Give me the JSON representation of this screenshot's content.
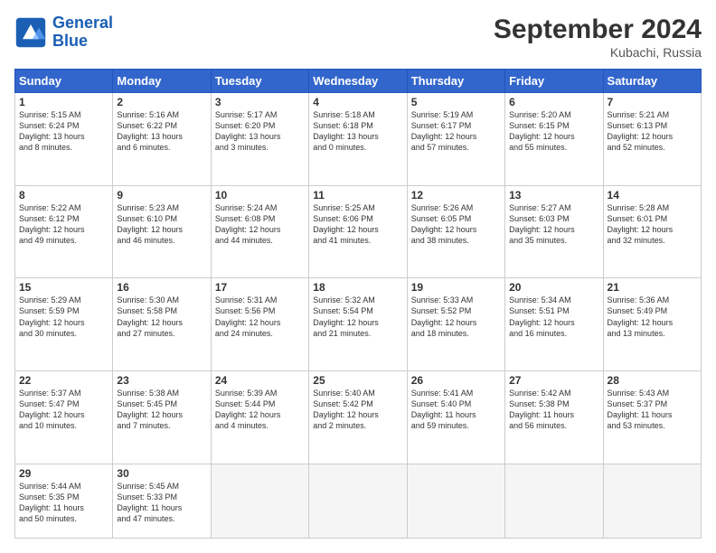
{
  "logo": {
    "line1": "General",
    "line2": "Blue"
  },
  "title": "September 2024",
  "location": "Kubachi, Russia",
  "days_header": [
    "Sunday",
    "Monday",
    "Tuesday",
    "Wednesday",
    "Thursday",
    "Friday",
    "Saturday"
  ],
  "weeks": [
    [
      {
        "day": "1",
        "info": "Sunrise: 5:15 AM\nSunset: 6:24 PM\nDaylight: 13 hours\nand 8 minutes."
      },
      {
        "day": "2",
        "info": "Sunrise: 5:16 AM\nSunset: 6:22 PM\nDaylight: 13 hours\nand 6 minutes."
      },
      {
        "day": "3",
        "info": "Sunrise: 5:17 AM\nSunset: 6:20 PM\nDaylight: 13 hours\nand 3 minutes."
      },
      {
        "day": "4",
        "info": "Sunrise: 5:18 AM\nSunset: 6:18 PM\nDaylight: 13 hours\nand 0 minutes."
      },
      {
        "day": "5",
        "info": "Sunrise: 5:19 AM\nSunset: 6:17 PM\nDaylight: 12 hours\nand 57 minutes."
      },
      {
        "day": "6",
        "info": "Sunrise: 5:20 AM\nSunset: 6:15 PM\nDaylight: 12 hours\nand 55 minutes."
      },
      {
        "day": "7",
        "info": "Sunrise: 5:21 AM\nSunset: 6:13 PM\nDaylight: 12 hours\nand 52 minutes."
      }
    ],
    [
      {
        "day": "8",
        "info": "Sunrise: 5:22 AM\nSunset: 6:12 PM\nDaylight: 12 hours\nand 49 minutes."
      },
      {
        "day": "9",
        "info": "Sunrise: 5:23 AM\nSunset: 6:10 PM\nDaylight: 12 hours\nand 46 minutes."
      },
      {
        "day": "10",
        "info": "Sunrise: 5:24 AM\nSunset: 6:08 PM\nDaylight: 12 hours\nand 44 minutes."
      },
      {
        "day": "11",
        "info": "Sunrise: 5:25 AM\nSunset: 6:06 PM\nDaylight: 12 hours\nand 41 minutes."
      },
      {
        "day": "12",
        "info": "Sunrise: 5:26 AM\nSunset: 6:05 PM\nDaylight: 12 hours\nand 38 minutes."
      },
      {
        "day": "13",
        "info": "Sunrise: 5:27 AM\nSunset: 6:03 PM\nDaylight: 12 hours\nand 35 minutes."
      },
      {
        "day": "14",
        "info": "Sunrise: 5:28 AM\nSunset: 6:01 PM\nDaylight: 12 hours\nand 32 minutes."
      }
    ],
    [
      {
        "day": "15",
        "info": "Sunrise: 5:29 AM\nSunset: 5:59 PM\nDaylight: 12 hours\nand 30 minutes."
      },
      {
        "day": "16",
        "info": "Sunrise: 5:30 AM\nSunset: 5:58 PM\nDaylight: 12 hours\nand 27 minutes."
      },
      {
        "day": "17",
        "info": "Sunrise: 5:31 AM\nSunset: 5:56 PM\nDaylight: 12 hours\nand 24 minutes."
      },
      {
        "day": "18",
        "info": "Sunrise: 5:32 AM\nSunset: 5:54 PM\nDaylight: 12 hours\nand 21 minutes."
      },
      {
        "day": "19",
        "info": "Sunrise: 5:33 AM\nSunset: 5:52 PM\nDaylight: 12 hours\nand 18 minutes."
      },
      {
        "day": "20",
        "info": "Sunrise: 5:34 AM\nSunset: 5:51 PM\nDaylight: 12 hours\nand 16 minutes."
      },
      {
        "day": "21",
        "info": "Sunrise: 5:36 AM\nSunset: 5:49 PM\nDaylight: 12 hours\nand 13 minutes."
      }
    ],
    [
      {
        "day": "22",
        "info": "Sunrise: 5:37 AM\nSunset: 5:47 PM\nDaylight: 12 hours\nand 10 minutes."
      },
      {
        "day": "23",
        "info": "Sunrise: 5:38 AM\nSunset: 5:45 PM\nDaylight: 12 hours\nand 7 minutes."
      },
      {
        "day": "24",
        "info": "Sunrise: 5:39 AM\nSunset: 5:44 PM\nDaylight: 12 hours\nand 4 minutes."
      },
      {
        "day": "25",
        "info": "Sunrise: 5:40 AM\nSunset: 5:42 PM\nDaylight: 12 hours\nand 2 minutes."
      },
      {
        "day": "26",
        "info": "Sunrise: 5:41 AM\nSunset: 5:40 PM\nDaylight: 11 hours\nand 59 minutes."
      },
      {
        "day": "27",
        "info": "Sunrise: 5:42 AM\nSunset: 5:38 PM\nDaylight: 11 hours\nand 56 minutes."
      },
      {
        "day": "28",
        "info": "Sunrise: 5:43 AM\nSunset: 5:37 PM\nDaylight: 11 hours\nand 53 minutes."
      }
    ],
    [
      {
        "day": "29",
        "info": "Sunrise: 5:44 AM\nSunset: 5:35 PM\nDaylight: 11 hours\nand 50 minutes."
      },
      {
        "day": "30",
        "info": "Sunrise: 5:45 AM\nSunset: 5:33 PM\nDaylight: 11 hours\nand 47 minutes."
      },
      null,
      null,
      null,
      null,
      null
    ]
  ]
}
